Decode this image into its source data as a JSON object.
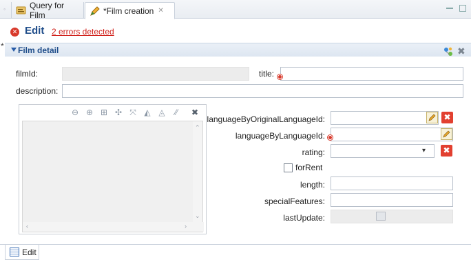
{
  "tabs": [
    {
      "label": "Query for Film",
      "active": false,
      "icon": "query-icon"
    },
    {
      "label": "*Film creation",
      "active": true,
      "icon": "edit-pencil-icon",
      "close": "✕"
    }
  ],
  "header": {
    "title": "Edit",
    "errors_link": "2 errors detected",
    "dirty_marker": "*"
  },
  "section": {
    "title": "Film detail",
    "icons": [
      "add-icon",
      "delete-icon"
    ]
  },
  "form": {
    "filmId": {
      "label": "filmId:",
      "value": "",
      "disabled": true
    },
    "title": {
      "label": "title:",
      "value": "",
      "error": true
    },
    "description": {
      "label": "description:",
      "value": ""
    },
    "languageByOriginalLanguageId": {
      "label": "languageByOriginalLanguageId:",
      "value": ""
    },
    "languageByLanguageId": {
      "label": "languageByLanguageId:",
      "value": "",
      "error": true
    },
    "rating": {
      "label": "rating:",
      "value": ""
    },
    "forRent": {
      "label": "forRent",
      "checked": false
    },
    "length": {
      "label": "length:",
      "value": ""
    },
    "specialFeatures": {
      "label": "specialFeatures:",
      "value": ""
    },
    "lastUpdate": {
      "label": "lastUpdate:",
      "value": ""
    }
  },
  "map_toolbar": {
    "tools": [
      "zoom-out-icon",
      "zoom-in-icon",
      "scale-icon",
      "pan-icon",
      "fit-extent-icon",
      "draw-area-icon",
      "draw-line-icon",
      "measure-icon",
      "clear-icon"
    ]
  },
  "bottom_tabs": [
    {
      "label": "Edit",
      "icon": "form-icon"
    }
  ],
  "colors": {
    "accent": "#1f4d8a",
    "error": "#d8392b",
    "section_bg": "#dde6f1"
  }
}
